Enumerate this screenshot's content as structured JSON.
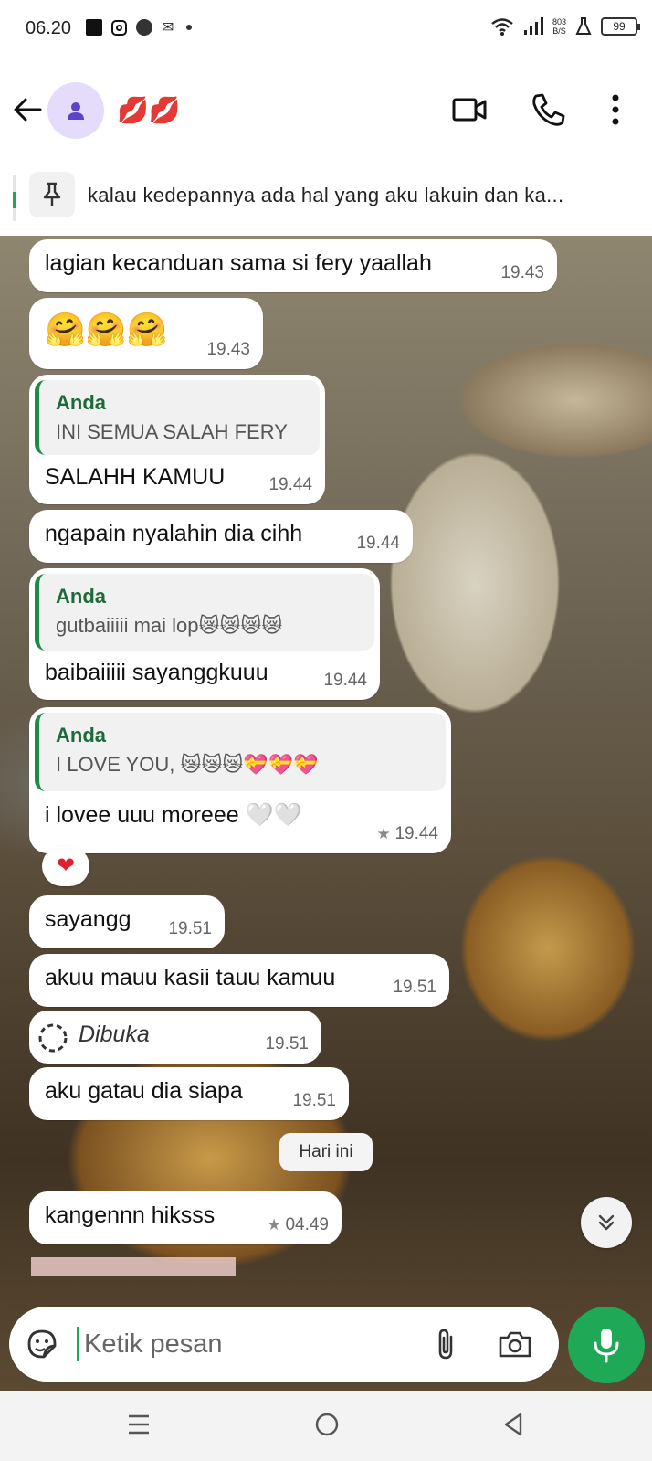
{
  "status_bar": {
    "time": "06.20",
    "net_speed_top": "803",
    "net_speed_bottom": "B/S",
    "battery": "99"
  },
  "header": {
    "contact_name": "💋💋"
  },
  "pinned": {
    "text": "kalau kedepannya ada hal yang aku lakuin dan ka..."
  },
  "messages": [
    {
      "text": "lagian kecanduan sama si fery yaallah",
      "time": "19.43"
    },
    {
      "text": "🤗🤗🤗",
      "time": "19.43"
    },
    {
      "quote_author": "Anda",
      "quote_text": "INI SEMUA SALAH FERY",
      "text": "SALAHH KAMUU",
      "time": "19.44"
    },
    {
      "text": "ngapain nyalahin dia cihh",
      "time": "19.44"
    },
    {
      "quote_author": "Anda",
      "quote_text": "gutbaiiiii mai lop😿😿😿😿",
      "text": "baibaiiiii sayanggkuuu",
      "time": "19.44"
    },
    {
      "quote_author": "Anda",
      "quote_text": "I LOVE YOU, 😿😿😿💝💝💝",
      "text": "i lovee uuu moreee 🤍🤍",
      "time": "19.44",
      "starred": true,
      "reaction": "❤"
    },
    {
      "text": "sayangg",
      "time": "19.51"
    },
    {
      "text": "akuu mauu kasii tauu kamuu",
      "time": "19.51"
    },
    {
      "text": "Dibuka",
      "time": "19.51",
      "view_once": true
    },
    {
      "text": "aku gatau dia siapa",
      "time": "19.51"
    },
    {
      "text": "kangennn hiksss",
      "time": "04.49",
      "starred": true
    }
  ],
  "day_separator": "Hari ini",
  "composer": {
    "placeholder": "Ketik pesan"
  },
  "colors": {
    "accent": "#1fa855",
    "quote_bar": "#1d8a47",
    "quote_author": "#1d6b3b",
    "reaction": "#e0202d"
  }
}
